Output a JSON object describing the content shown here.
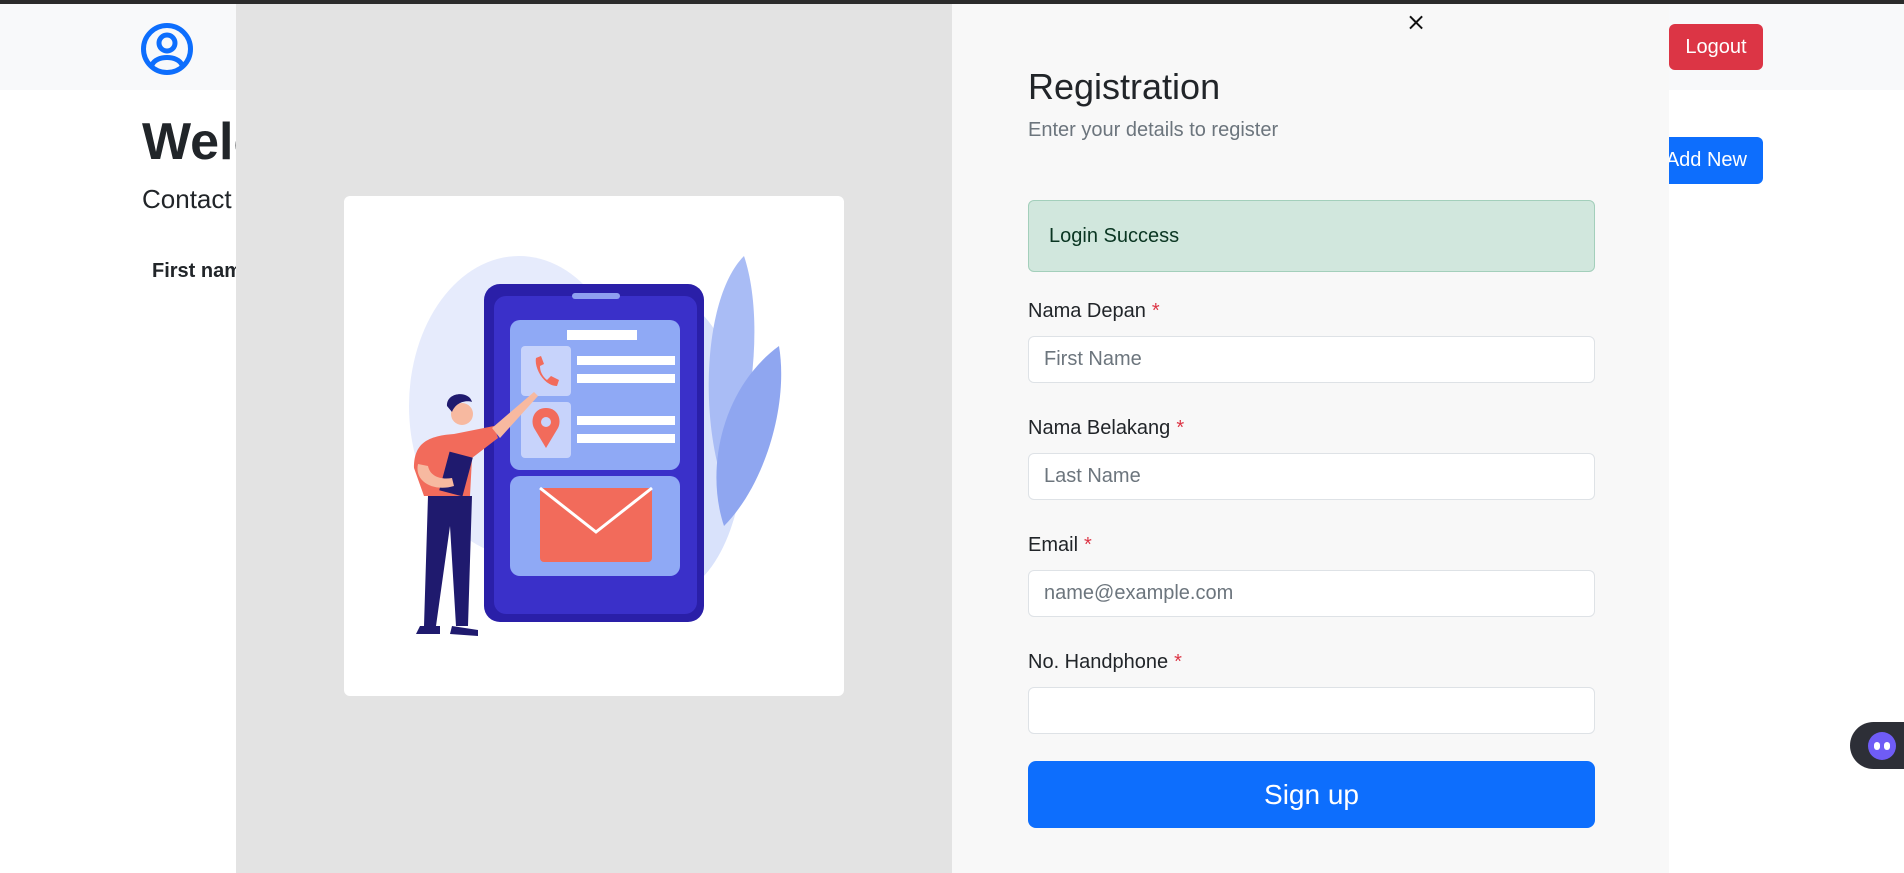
{
  "background": {
    "heading_partial": "Welc",
    "subheading_partial": "Contact",
    "table_header_partial": "First nam",
    "logout_label": "Logout",
    "add_new_label": "Add New"
  },
  "modal": {
    "close_symbol": "×",
    "title": "Registration",
    "subtitle": "Enter your details to register",
    "alert_text": "Login Success",
    "fields": [
      {
        "label": "Nama Depan",
        "required_mark": "*",
        "placeholder": "First Name",
        "value": ""
      },
      {
        "label": "Nama Belakang",
        "required_mark": "*",
        "placeholder": "Last Name",
        "value": ""
      },
      {
        "label": "Email",
        "required_mark": "*",
        "placeholder": "name@example.com",
        "value": ""
      },
      {
        "label": "No. Handphone",
        "required_mark": "*",
        "placeholder": "",
        "value": ""
      }
    ],
    "submit_label": "Sign up"
  },
  "icons": {
    "nav_avatar": "user-circle-icon",
    "close": "close-icon",
    "chat": "chat-bot-icon",
    "illustration": "contact-phone-illustration"
  },
  "colors": {
    "primary": "#0d6efd",
    "danger": "#dc3545",
    "success_bg": "#d1e7dd",
    "modal_left_bg": "#e3e3e3"
  }
}
